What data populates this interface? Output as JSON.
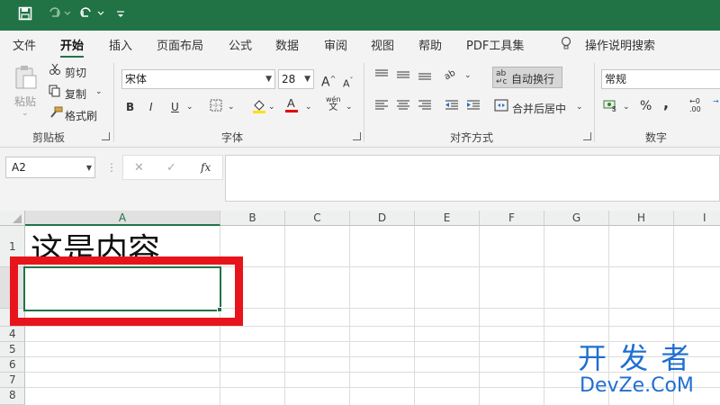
{
  "quick_access": {
    "save_icon": "save-icon",
    "redo_icon": "redo-icon",
    "undo_icon": "undo-icon",
    "customize_icon": "customize-icon"
  },
  "tabs": [
    {
      "label": "文件"
    },
    {
      "label": "开始",
      "active": true
    },
    {
      "label": "插入"
    },
    {
      "label": "页面布局"
    },
    {
      "label": "公式"
    },
    {
      "label": "数据"
    },
    {
      "label": "审阅"
    },
    {
      "label": "视图"
    },
    {
      "label": "帮助"
    },
    {
      "label": "PDF工具集"
    }
  ],
  "tell_me": "操作说明搜索",
  "clipboard": {
    "paste": "粘贴",
    "cut": "剪切",
    "copy": "复制",
    "format_painter": "格式刷",
    "group": "剪贴板"
  },
  "font": {
    "name": "宋体",
    "size": "28",
    "group": "字体",
    "bold": "B",
    "italic": "I",
    "underline": "U",
    "grow": "A",
    "shrink": "A",
    "phonetic_top": "wén",
    "phonetic_bottom": "文"
  },
  "alignment": {
    "wrap_text": "自动换行",
    "merge_center": "合并后居中",
    "group": "对齐方式",
    "orientation": "ab"
  },
  "number": {
    "format": "常规",
    "percent": "%",
    "comma": ",",
    "inc_decimal_top": "←0",
    "inc_decimal_bottom": ".00",
    "group": "数字"
  },
  "formula_bar": {
    "name_box": "A2",
    "fx": "fx",
    "cancel": "✕",
    "enter": "✓",
    "more": "⋮"
  },
  "columns": [
    "A",
    "B",
    "C",
    "D",
    "E",
    "F",
    "G",
    "H",
    "I"
  ],
  "rows": [
    "1",
    "2",
    "3",
    "4",
    "5",
    "6",
    "7",
    "8"
  ],
  "cell_a1": "这是内容",
  "watermark": {
    "line1": "开 发 者",
    "line2": "DevZe.CoM"
  },
  "colors": {
    "excel_green": "#217346",
    "highlight_red": "#e8141b",
    "watermark_blue": "#1f6fd1",
    "font_color_red": "#e00000",
    "fill_yellow": "#ffe000"
  }
}
